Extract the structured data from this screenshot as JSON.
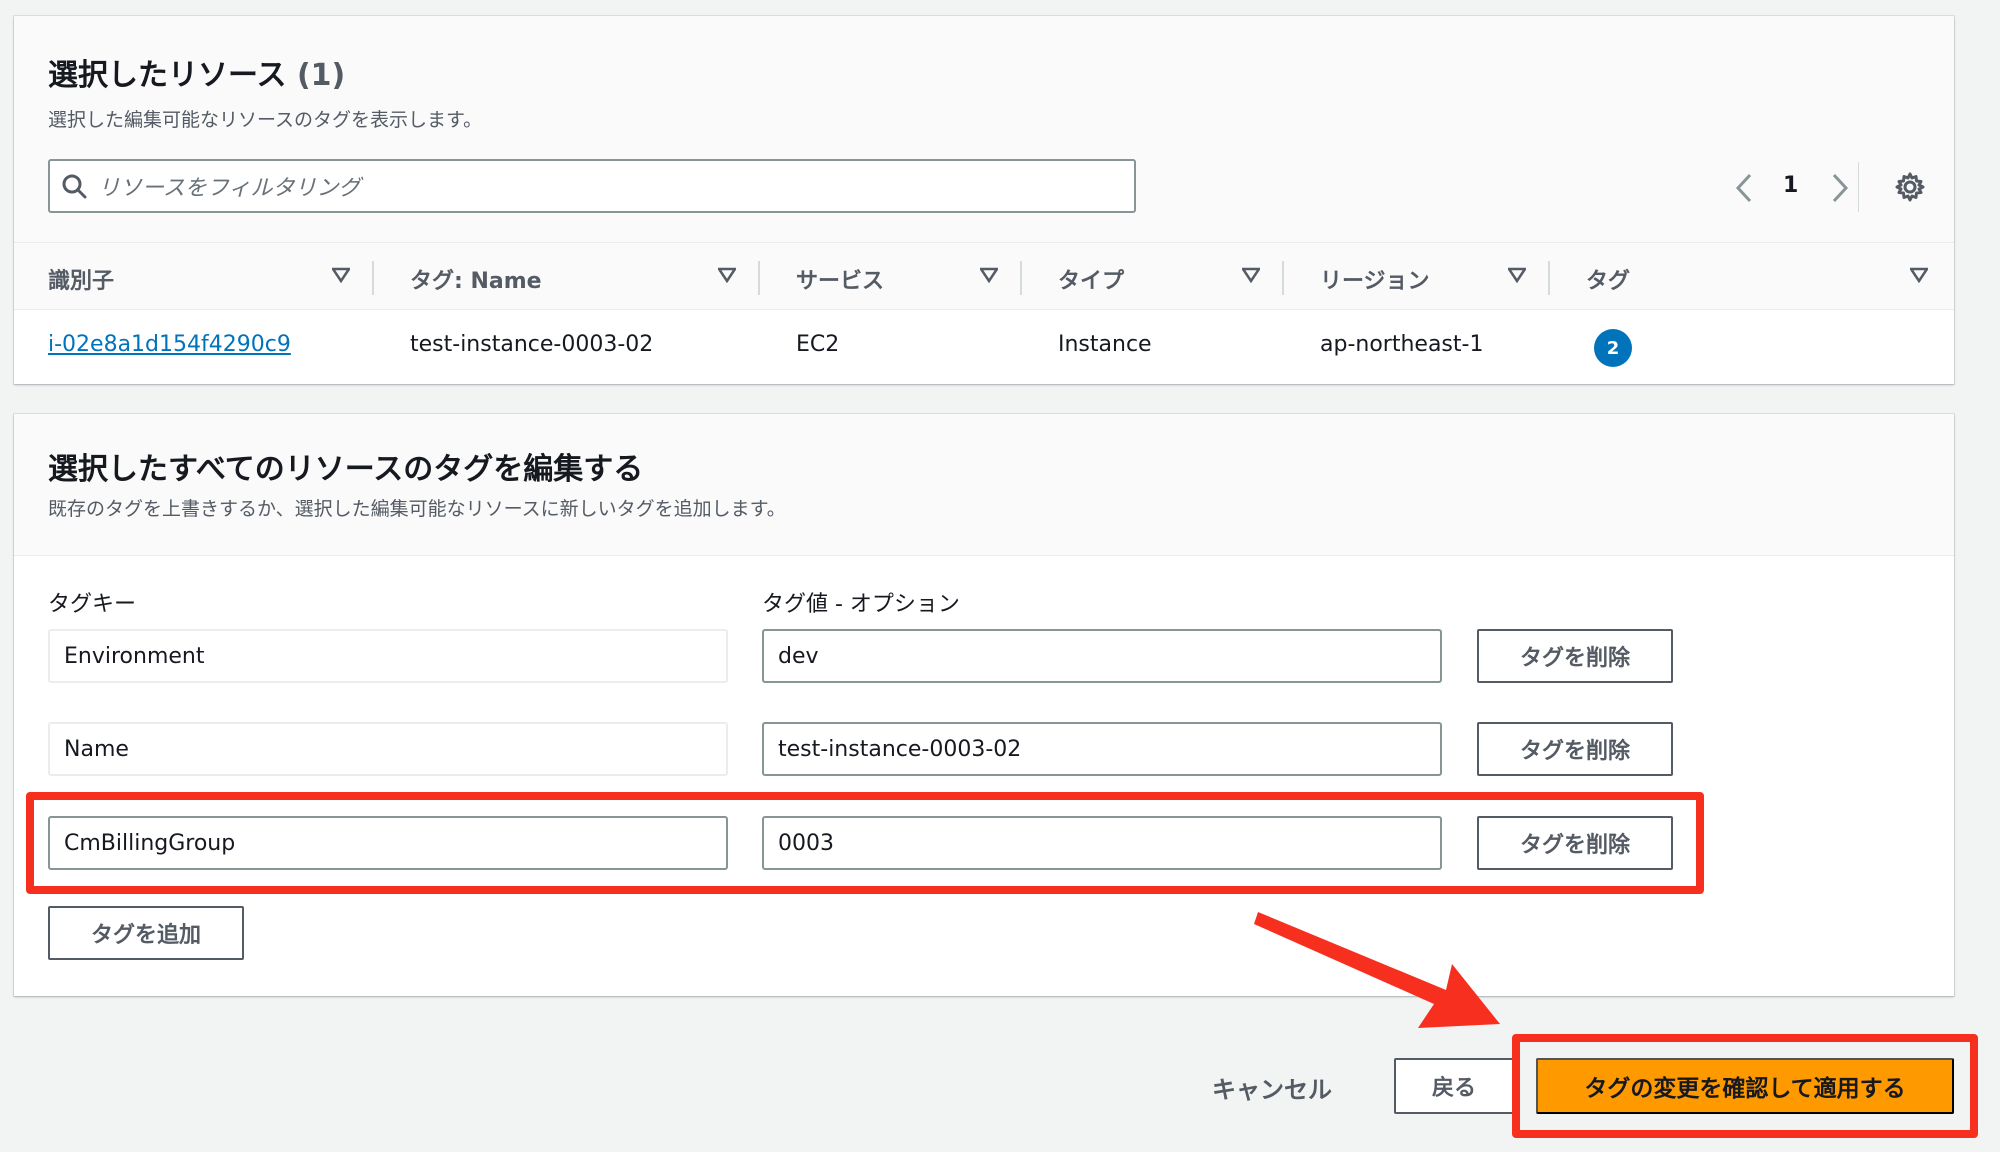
{
  "resources": {
    "title": "選択したリソース",
    "count": "(1)",
    "description": "選択した編集可能なリソースのタグを表示します。",
    "search_placeholder": "リソースをフィルタリング",
    "page_number": "1",
    "columns": [
      "識別子",
      "タグ: Name",
      "サービス",
      "タイプ",
      "リージョン",
      "タグ"
    ],
    "rows": [
      {
        "id": "i-02e8a1d154f4290c9",
        "name": "test-instance-0003-02",
        "service": "EC2",
        "type": "Instance",
        "region": "ap-northeast-1",
        "tag_count": "2"
      }
    ]
  },
  "tag_editor": {
    "title": "選択したすべてのリソースのタグを編集する",
    "description": "既存のタグを上書きするか、選択した編集可能なリソースに新しいタグを追加します。",
    "key_label": "タグキー",
    "value_label": "タグ値 - オプション",
    "tags": [
      {
        "key": "Environment",
        "value": "dev",
        "remove_label": "タグを削除"
      },
      {
        "key": "Name",
        "value": "test-instance-0003-02",
        "remove_label": "タグを削除"
      },
      {
        "key": "CmBillingGroup",
        "value": "0003",
        "remove_label": "タグを削除"
      }
    ],
    "add_label": "タグを追加"
  },
  "footer": {
    "cancel_label": "キャンセル",
    "back_label": "戻る",
    "apply_label": "タグの変更を確認して適用する"
  },
  "colors": {
    "accent_orange": "#ff9900",
    "link_blue": "#0073bb",
    "annotation_red": "#f72f1f"
  }
}
